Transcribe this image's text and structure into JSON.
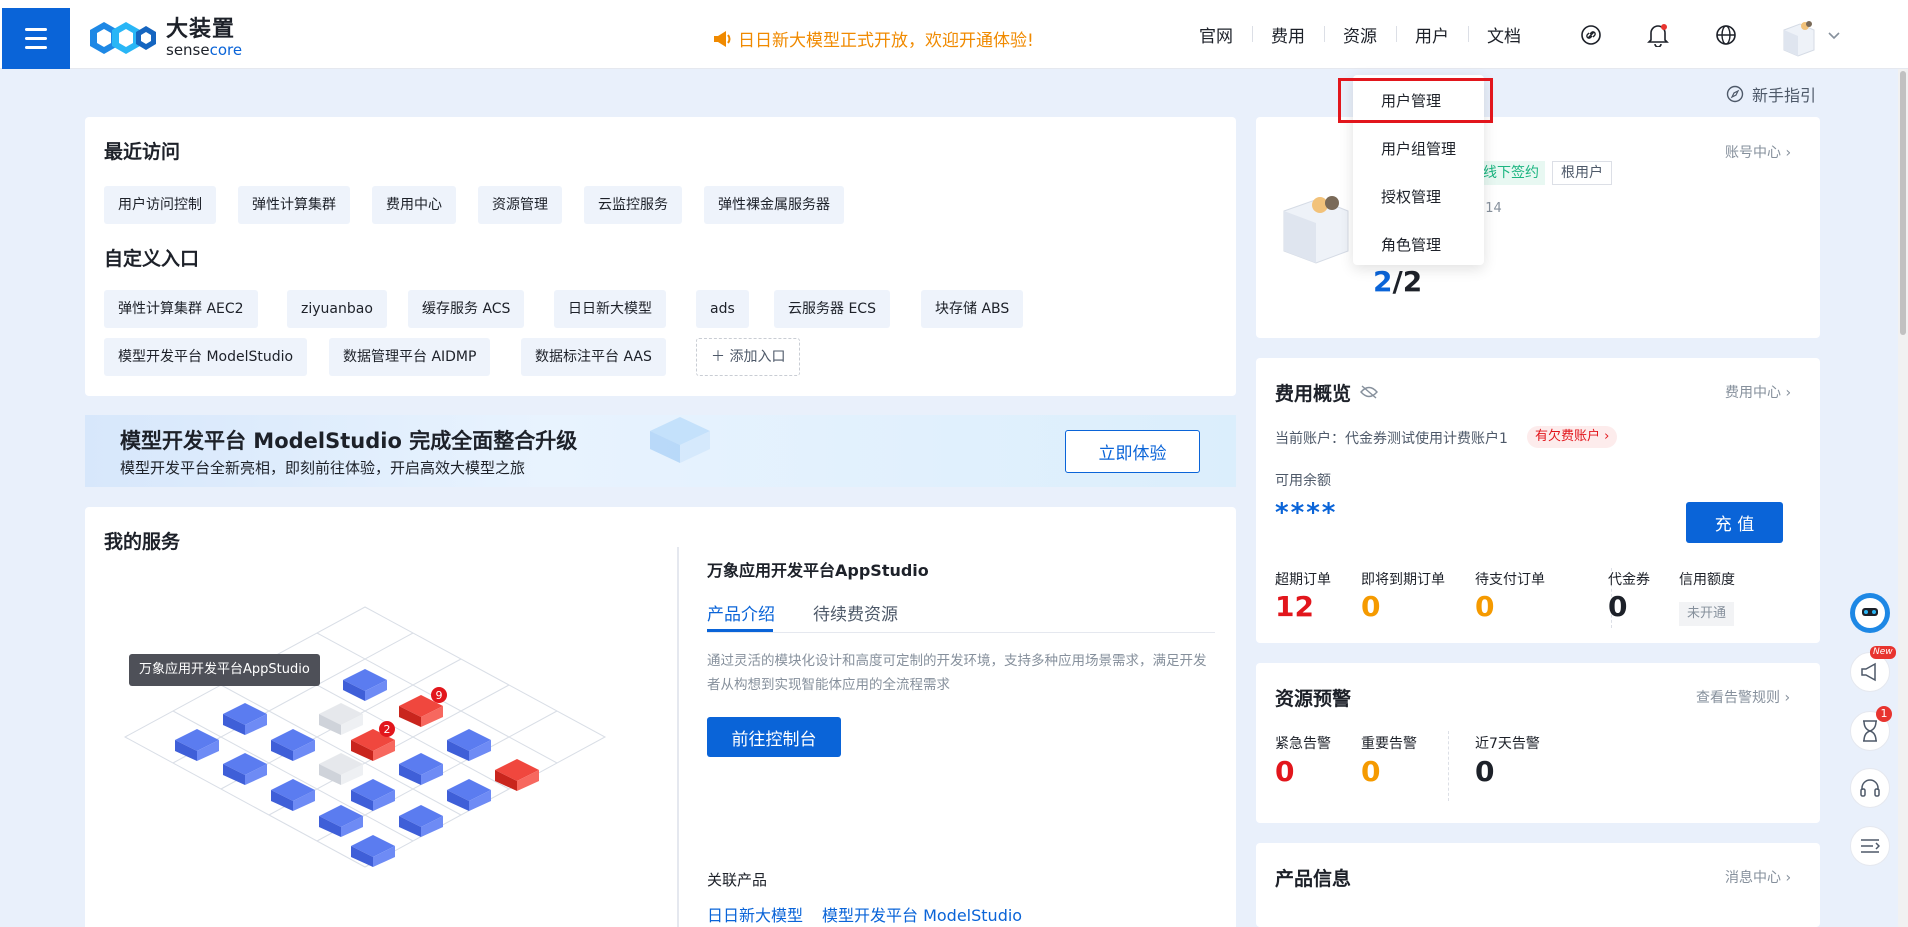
{
  "header": {
    "logo_cn": "大装置",
    "logo_en_a": "sense",
    "logo_en_b": "core",
    "announcement": "日日新大模型正式开放，欢迎开通体验!",
    "nav": [
      "官网",
      "费用",
      "资源",
      "用户",
      "文档"
    ]
  },
  "user_dropdown": {
    "items": [
      "用户管理",
      "用户组管理",
      "授权管理",
      "角色管理"
    ],
    "highlighted": "用户管理"
  },
  "guide_label": "新手指引",
  "recent": {
    "title": "最近访问",
    "items": [
      "用户访问控制",
      "弹性计算集群",
      "费用中心",
      "资源管理",
      "云监控服务",
      "弹性裸金属服务器"
    ]
  },
  "custom": {
    "title": "自定义入口",
    "items": [
      "弹性计算集群 AEC2",
      "ziyuanbao",
      "缓存服务 ACS",
      "日日新大模型",
      "ads",
      "云服务器 ECS",
      "块存储 ABS",
      "模型开发平台 ModelStudio",
      "数据管理平台 AIDMP",
      "数据标注平台 AAS"
    ],
    "add_label": "添加入口"
  },
  "banner": {
    "title": "模型开发平台 ModelStudio 完成全面整合升级",
    "subtitle": "模型开发平台全新亮相，即刻前往体验，开启高效大模型之旅",
    "button": "立即体验"
  },
  "services": {
    "title": "我的服务",
    "tooltip": "万象应用开发平台AppStudio",
    "badge_a": "9",
    "badge_b": "2",
    "product_name": "万象应用开发平台AppStudio",
    "tabs": [
      "产品介绍",
      "待续费资源"
    ],
    "description": "通过灵活的模块化设计和高度可定制的开发环境，支持多种应用场景需求，满足开发者从构想到实现智能体应用的全流程需求",
    "console_button": "前往控制台",
    "related_title": "关联产品",
    "related": [
      "日日新大模型",
      "模型开发平台 ModelStudio"
    ]
  },
  "account": {
    "center_link": "账号中心",
    "tag_sign": "线下签约",
    "tag_root": "根用户",
    "id_fragment": "214",
    "count_a": "2",
    "count_sep": "/",
    "count_b": "2"
  },
  "fee": {
    "title": "费用概览",
    "center_link": "费用中心",
    "current_account": "当前账户：代金券测试使用计费账户1",
    "arrears_tag": "有欠费账户",
    "balance_label": "可用余额",
    "balance_value": "****",
    "recharge": "充 值",
    "stats": [
      {
        "label": "超期订单",
        "value": "12",
        "color": "#e2161c"
      },
      {
        "label": "即将到期订单",
        "value": "0",
        "color": "#f59a00"
      },
      {
        "label": "待支付订单",
        "value": "0",
        "color": "#f59a00"
      },
      {
        "label": "代金券",
        "value": "0",
        "color": "#1d2129"
      },
      {
        "label": "信用额度",
        "value": "未开通",
        "color": "#86909c"
      }
    ]
  },
  "alert": {
    "title": "资源预警",
    "rules_link": "查看告警规则",
    "stats": [
      {
        "label": "紧急告警",
        "value": "0",
        "color": "#e2161c"
      },
      {
        "label": "重要告警",
        "value": "0",
        "color": "#f59a00"
      },
      {
        "label": "近7天告警",
        "value": "0",
        "color": "#1d2129"
      }
    ]
  },
  "product_info": {
    "title": "产品信息",
    "center_link": "消息中心"
  },
  "side_tools": {
    "new_badge": "New",
    "count_badge": "1"
  }
}
